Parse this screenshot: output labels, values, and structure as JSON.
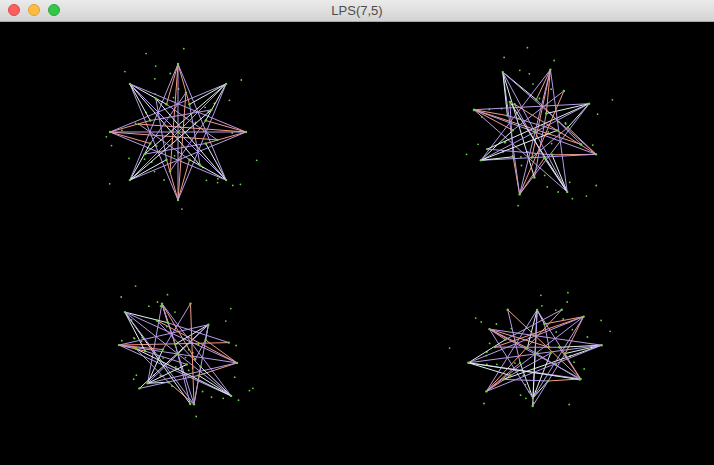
{
  "window": {
    "title": "LPS(7,5)"
  },
  "edges": [
    {
      "color": "#f39b86"
    },
    {
      "color": "#dff3ee"
    },
    {
      "color": "#b79be6"
    }
  ],
  "dots": {
    "color": "#6bd43a"
  },
  "figures": [
    {
      "kind": "front"
    },
    {
      "kind": "tilted"
    },
    {
      "kind": "oblique"
    },
    {
      "kind": "skewed"
    }
  ]
}
